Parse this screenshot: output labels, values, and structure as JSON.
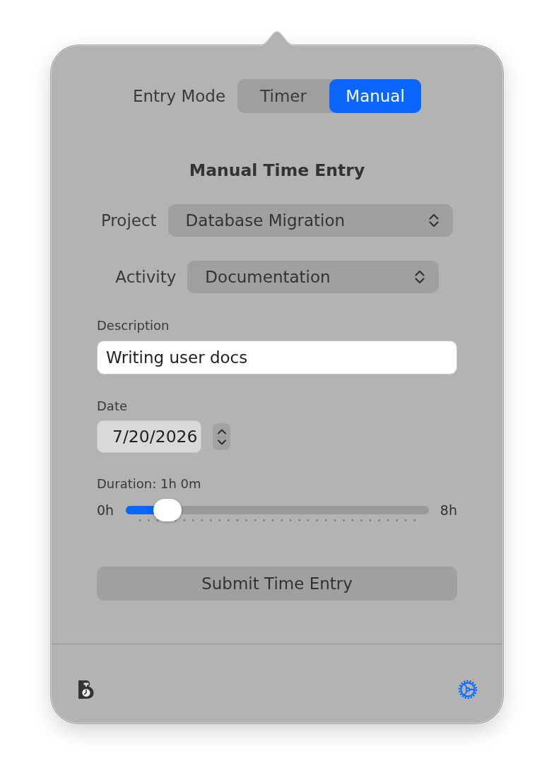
{
  "entry_mode": {
    "label": "Entry Mode",
    "segments": [
      {
        "label": "Timer",
        "selected": false
      },
      {
        "label": "Manual",
        "selected": true
      }
    ]
  },
  "form": {
    "title": "Manual Time Entry",
    "project": {
      "label": "Project",
      "value": "Database Migration"
    },
    "activity": {
      "label": "Activity",
      "value": "Documentation"
    },
    "description": {
      "label": "Description",
      "value": "Writing user docs"
    },
    "date": {
      "label": "Date",
      "value": "7/20/2026"
    },
    "duration": {
      "label": "Duration: 1h 0m",
      "min_label": "0h",
      "max_label": "8h",
      "level": 0.1
    },
    "submit": {
      "label": "Submit Time Entry"
    }
  }
}
